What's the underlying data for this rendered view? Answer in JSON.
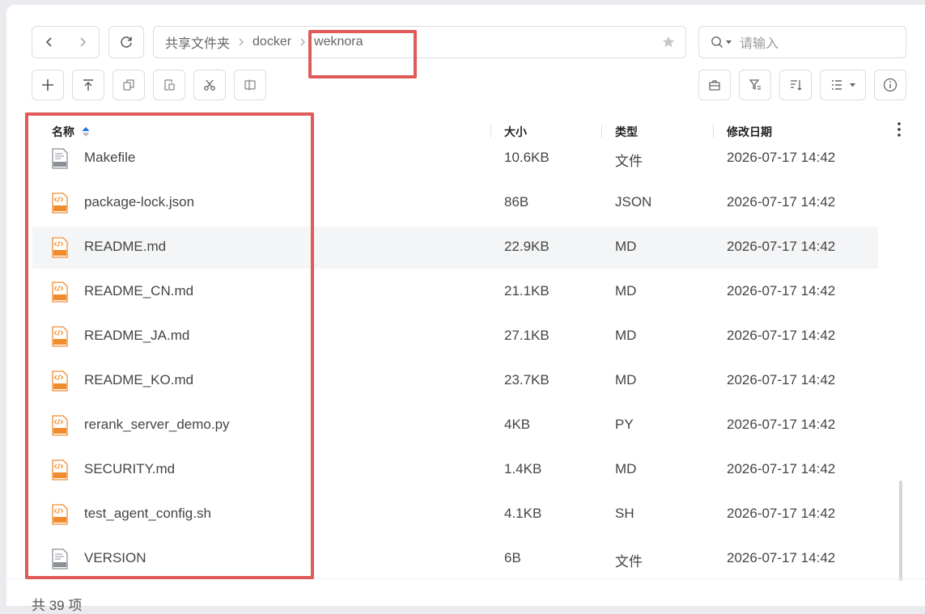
{
  "nav": {
    "back_label": "back",
    "forward_label": "forward"
  },
  "path": {
    "crumbs": [
      "共享文件夹",
      "docker",
      "weknora"
    ]
  },
  "search": {
    "placeholder": "请输入"
  },
  "columns": {
    "name": "名称",
    "size": "大小",
    "type": "类型",
    "modified": "修改日期"
  },
  "files": [
    {
      "name": "Makefile",
      "size": "10.6KB",
      "type": "文件",
      "modified": "2026-07-17 14:42",
      "icon": "text-file-icon",
      "badge": "TXT"
    },
    {
      "name": "package-lock.json",
      "size": "86B",
      "type": "JSON",
      "modified": "2026-07-17 14:42",
      "icon": "code-file-icon",
      "badge": "JSON"
    },
    {
      "name": "README.md",
      "size": "22.9KB",
      "type": "MD",
      "modified": "2026-07-17 14:42",
      "icon": "code-file-icon",
      "badge": "MD"
    },
    {
      "name": "README_CN.md",
      "size": "21.1KB",
      "type": "MD",
      "modified": "2026-07-17 14:42",
      "icon": "code-file-icon",
      "badge": "MD"
    },
    {
      "name": "README_JA.md",
      "size": "27.1KB",
      "type": "MD",
      "modified": "2026-07-17 14:42",
      "icon": "code-file-icon",
      "badge": "MD"
    },
    {
      "name": "README_KO.md",
      "size": "23.7KB",
      "type": "MD",
      "modified": "2026-07-17 14:42",
      "icon": "code-file-icon",
      "badge": "MD"
    },
    {
      "name": "rerank_server_demo.py",
      "size": "4KB",
      "type": "PY",
      "modified": "2026-07-17 14:42",
      "icon": "code-file-icon",
      "badge": "PY"
    },
    {
      "name": "SECURITY.md",
      "size": "1.4KB",
      "type": "MD",
      "modified": "2026-07-17 14:42",
      "icon": "code-file-icon",
      "badge": "MD"
    },
    {
      "name": "test_agent_config.sh",
      "size": "4.1KB",
      "type": "SH",
      "modified": "2026-07-17 14:42",
      "icon": "code-file-icon",
      "badge": "SH"
    },
    {
      "name": "VERSION",
      "size": "6B",
      "type": "文件",
      "modified": "2026-07-17 14:42",
      "icon": "text-file-icon",
      "badge": "TXT"
    }
  ],
  "highlighted_row": 2,
  "footer": {
    "count_text": "共 39 项"
  },
  "colors": {
    "accent": "#1a73e8",
    "annotation_red": "#e05a5a",
    "code_icon_orange": "#f08c2e"
  }
}
